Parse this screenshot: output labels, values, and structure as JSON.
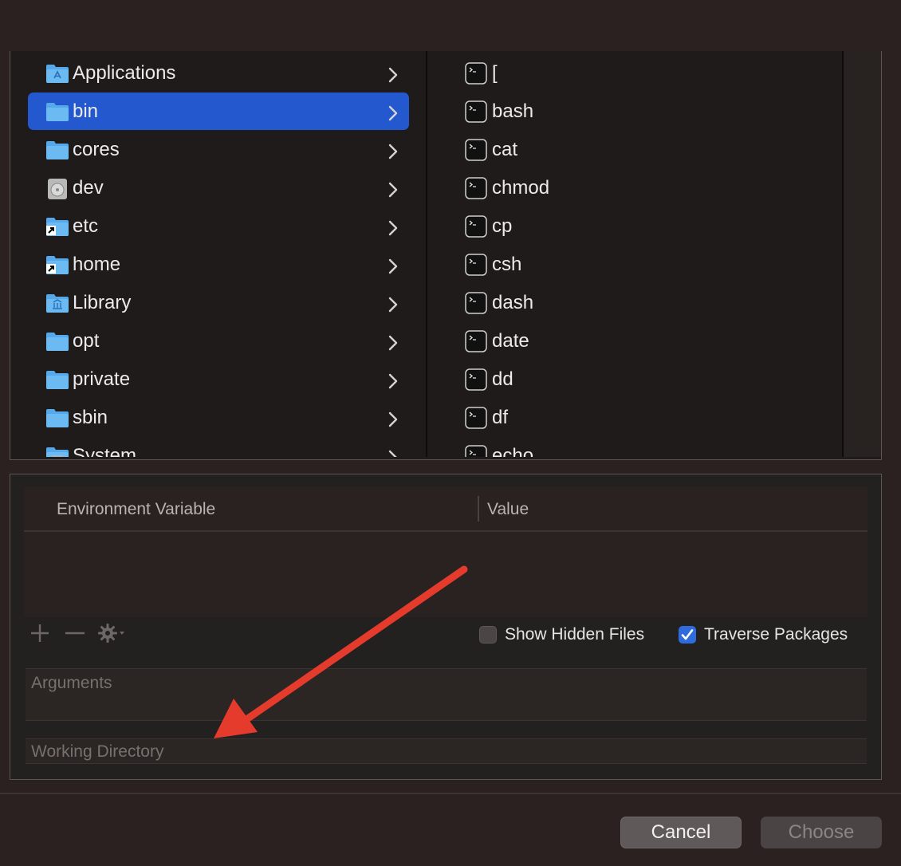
{
  "browser": {
    "left_items": [
      {
        "label": "Applications",
        "icon": "applications-folder-icon",
        "selected": false
      },
      {
        "label": "bin",
        "icon": "folder-icon",
        "selected": true
      },
      {
        "label": "cores",
        "icon": "folder-icon",
        "selected": false
      },
      {
        "label": "dev",
        "icon": "disk-icon",
        "selected": false
      },
      {
        "label": "etc",
        "icon": "alias-folder-icon",
        "selected": false
      },
      {
        "label": "home",
        "icon": "alias-folder-icon",
        "selected": false
      },
      {
        "label": "Library",
        "icon": "library-folder-icon",
        "selected": false
      },
      {
        "label": "opt",
        "icon": "folder-icon",
        "selected": false
      },
      {
        "label": "private",
        "icon": "folder-icon",
        "selected": false
      },
      {
        "label": "sbin",
        "icon": "folder-icon",
        "selected": false
      },
      {
        "label": "System",
        "icon": "system-folder-icon",
        "selected": false
      }
    ],
    "right_items": [
      {
        "label": "["
      },
      {
        "label": "bash"
      },
      {
        "label": "cat"
      },
      {
        "label": "chmod"
      },
      {
        "label": "cp"
      },
      {
        "label": "csh"
      },
      {
        "label": "dash"
      },
      {
        "label": "date"
      },
      {
        "label": "dd"
      },
      {
        "label": "df"
      },
      {
        "label": "echo"
      }
    ]
  },
  "env_table": {
    "col1": "Environment Variable",
    "col2": "Value"
  },
  "options": {
    "show_hidden_label": "Show Hidden Files",
    "show_hidden_checked": false,
    "traverse_label": "Traverse Packages",
    "traverse_checked": true
  },
  "fields": {
    "arguments_placeholder": "Arguments",
    "working_dir_placeholder": "Working Directory"
  },
  "buttons": {
    "cancel": "Cancel",
    "choose": "Choose"
  },
  "colors": {
    "selection": "#2458cf",
    "folder": "#55a9ea",
    "annotation_arrow": "#e43b2c"
  }
}
